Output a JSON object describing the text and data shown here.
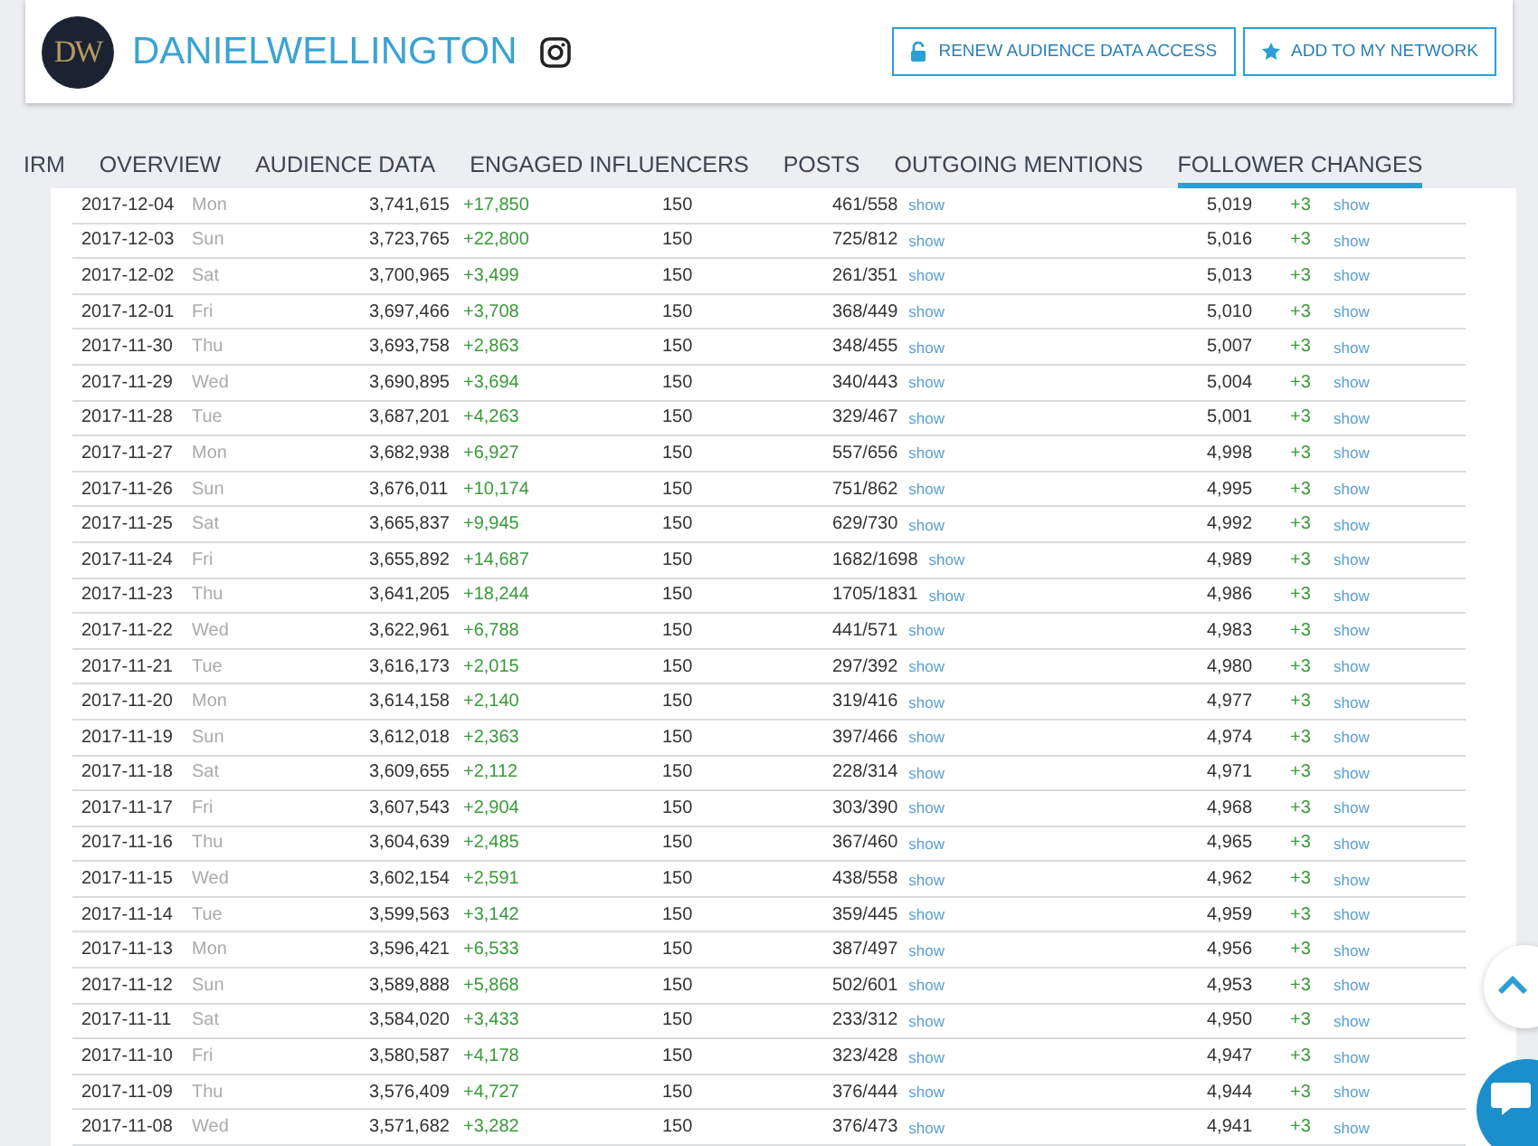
{
  "profile": {
    "logo_text": "DW",
    "name": "DANIELWELLINGTON"
  },
  "buttons": [
    {
      "label": "RENEW AUDIENCE DATA ACCESS",
      "kind": "lock"
    },
    {
      "label": "ADD TO MY NETWORK",
      "kind": "star"
    }
  ],
  "tabs": [
    {
      "label": "IRM",
      "selected": false
    },
    {
      "label": "OVERVIEW",
      "selected": false
    },
    {
      "label": "AUDIENCE DATA",
      "selected": false
    },
    {
      "label": "ENGAGED INFLUENCERS",
      "selected": false
    },
    {
      "label": "POSTS",
      "selected": false
    },
    {
      "label": "OUTGOING MENTIONS",
      "selected": false
    },
    {
      "label": "FOLLOWER CHANGES",
      "selected": true
    }
  ],
  "table": {
    "rows": [
      {
        "date": "2017-12-04",
        "weekday": "Mon",
        "count": "3,741,615",
        "change": "+17,850",
        "column_3": "150",
        "ratio": "461/558",
        "ratio_link": "show",
        "column_5": "5,019",
        "column_5_change": "+3",
        "column_5_link": "show"
      },
      {
        "date": "2017-12-03",
        "weekday": "Sun",
        "count": "3,723,765",
        "change": "+22,800",
        "column_3": "150",
        "ratio": "725/812",
        "ratio_link": "show",
        "column_5": "5,016",
        "column_5_change": "+3",
        "column_5_link": "show"
      },
      {
        "date": "2017-12-02",
        "weekday": "Sat",
        "count": "3,700,965",
        "change": "+3,499",
        "column_3": "150",
        "ratio": "261/351",
        "ratio_link": "show",
        "column_5": "5,013",
        "column_5_change": "+3",
        "column_5_link": "show"
      },
      {
        "date": "2017-12-01",
        "weekday": "Fri",
        "count": "3,697,466",
        "change": "+3,708",
        "column_3": "150",
        "ratio": "368/449",
        "ratio_link": "show",
        "column_5": "5,010",
        "column_5_change": "+3",
        "column_5_link": "show"
      },
      {
        "date": "2017-11-30",
        "weekday": "Thu",
        "count": "3,693,758",
        "change": "+2,863",
        "column_3": "150",
        "ratio": "348/455",
        "ratio_link": "show",
        "column_5": "5,007",
        "column_5_change": "+3",
        "column_5_link": "show"
      },
      {
        "date": "2017-11-29",
        "weekday": "Wed",
        "count": "3,690,895",
        "change": "+3,694",
        "column_3": "150",
        "ratio": "340/443",
        "ratio_link": "show",
        "column_5": "5,004",
        "column_5_change": "+3",
        "column_5_link": "show"
      },
      {
        "date": "2017-11-28",
        "weekday": "Tue",
        "count": "3,687,201",
        "change": "+4,263",
        "column_3": "150",
        "ratio": "329/467",
        "ratio_link": "show",
        "column_5": "5,001",
        "column_5_change": "+3",
        "column_5_link": "show"
      },
      {
        "date": "2017-11-27",
        "weekday": "Mon",
        "count": "3,682,938",
        "change": "+6,927",
        "column_3": "150",
        "ratio": "557/656",
        "ratio_link": "show",
        "column_5": "4,998",
        "column_5_change": "+3",
        "column_5_link": "show"
      },
      {
        "date": "2017-11-26",
        "weekday": "Sun",
        "count": "3,676,011",
        "change": "+10,174",
        "column_3": "150",
        "ratio": "751/862",
        "ratio_link": "show",
        "column_5": "4,995",
        "column_5_change": "+3",
        "column_5_link": "show"
      },
      {
        "date": "2017-11-25",
        "weekday": "Sat",
        "count": "3,665,837",
        "change": "+9,945",
        "column_3": "150",
        "ratio": "629/730",
        "ratio_link": "show",
        "column_5": "4,992",
        "column_5_change": "+3",
        "column_5_link": "show"
      },
      {
        "date": "2017-11-24",
        "weekday": "Fri",
        "count": "3,655,892",
        "change": "+14,687",
        "column_3": "150",
        "ratio": "1682/1698",
        "ratio_link": "show",
        "column_5": "4,989",
        "column_5_change": "+3",
        "column_5_link": "show"
      },
      {
        "date": "2017-11-23",
        "weekday": "Thu",
        "count": "3,641,205",
        "change": "+18,244",
        "column_3": "150",
        "ratio": "1705/1831",
        "ratio_link": "show",
        "column_5": "4,986",
        "column_5_change": "+3",
        "column_5_link": "show"
      },
      {
        "date": "2017-11-22",
        "weekday": "Wed",
        "count": "3,622,961",
        "change": "+6,788",
        "column_3": "150",
        "ratio": "441/571",
        "ratio_link": "show",
        "column_5": "4,983",
        "column_5_change": "+3",
        "column_5_link": "show"
      },
      {
        "date": "2017-11-21",
        "weekday": "Tue",
        "count": "3,616,173",
        "change": "+2,015",
        "column_3": "150",
        "ratio": "297/392",
        "ratio_link": "show",
        "column_5": "4,980",
        "column_5_change": "+3",
        "column_5_link": "show"
      },
      {
        "date": "2017-11-20",
        "weekday": "Mon",
        "count": "3,614,158",
        "change": "+2,140",
        "column_3": "150",
        "ratio": "319/416",
        "ratio_link": "show",
        "column_5": "4,977",
        "column_5_change": "+3",
        "column_5_link": "show"
      },
      {
        "date": "2017-11-19",
        "weekday": "Sun",
        "count": "3,612,018",
        "change": "+2,363",
        "column_3": "150",
        "ratio": "397/466",
        "ratio_link": "show",
        "column_5": "4,974",
        "column_5_change": "+3",
        "column_5_link": "show"
      },
      {
        "date": "2017-11-18",
        "weekday": "Sat",
        "count": "3,609,655",
        "change": "+2,112",
        "column_3": "150",
        "ratio": "228/314",
        "ratio_link": "show",
        "column_5": "4,971",
        "column_5_change": "+3",
        "column_5_link": "show"
      },
      {
        "date": "2017-11-17",
        "weekday": "Fri",
        "count": "3,607,543",
        "change": "+2,904",
        "column_3": "150",
        "ratio": "303/390",
        "ratio_link": "show",
        "column_5": "4,968",
        "column_5_change": "+3",
        "column_5_link": "show"
      },
      {
        "date": "2017-11-16",
        "weekday": "Thu",
        "count": "3,604,639",
        "change": "+2,485",
        "column_3": "150",
        "ratio": "367/460",
        "ratio_link": "show",
        "column_5": "4,965",
        "column_5_change": "+3",
        "column_5_link": "show"
      },
      {
        "date": "2017-11-15",
        "weekday": "Wed",
        "count": "3,602,154",
        "change": "+2,591",
        "column_3": "150",
        "ratio": "438/558",
        "ratio_link": "show",
        "column_5": "4,962",
        "column_5_change": "+3",
        "column_5_link": "show"
      },
      {
        "date": "2017-11-14",
        "weekday": "Tue",
        "count": "3,599,563",
        "change": "+3,142",
        "column_3": "150",
        "ratio": "359/445",
        "ratio_link": "show",
        "column_5": "4,959",
        "column_5_change": "+3",
        "column_5_link": "show"
      },
      {
        "date": "2017-11-13",
        "weekday": "Mon",
        "count": "3,596,421",
        "change": "+6,533",
        "column_3": "150",
        "ratio": "387/497",
        "ratio_link": "show",
        "column_5": "4,956",
        "column_5_change": "+3",
        "column_5_link": "show"
      },
      {
        "date": "2017-11-12",
        "weekday": "Sun",
        "count": "3,589,888",
        "change": "+5,868",
        "column_3": "150",
        "ratio": "502/601",
        "ratio_link": "show",
        "column_5": "4,953",
        "column_5_change": "+3",
        "column_5_link": "show"
      },
      {
        "date": "2017-11-11",
        "weekday": "Sat",
        "count": "3,584,020",
        "change": "+3,433",
        "column_3": "150",
        "ratio": "233/312",
        "ratio_link": "show",
        "column_5": "4,950",
        "column_5_change": "+3",
        "column_5_link": "show"
      },
      {
        "date": "2017-11-10",
        "weekday": "Fri",
        "count": "3,580,587",
        "change": "+4,178",
        "column_3": "150",
        "ratio": "323/428",
        "ratio_link": "show",
        "column_5": "4,947",
        "column_5_change": "+3",
        "column_5_link": "show"
      },
      {
        "date": "2017-11-09",
        "weekday": "Thu",
        "count": "3,576,409",
        "change": "+4,727",
        "column_3": "150",
        "ratio": "376/444",
        "ratio_link": "show",
        "column_5": "4,944",
        "column_5_change": "+3",
        "column_5_link": "show"
      },
      {
        "date": "2017-11-08",
        "weekday": "Wed",
        "count": "3,571,682",
        "change": "+3,282",
        "column_3": "150",
        "ratio": "376/473",
        "ratio_link": "show",
        "column_5": "4,941",
        "column_5_change": "+3",
        "column_5_link": "show"
      }
    ]
  }
}
